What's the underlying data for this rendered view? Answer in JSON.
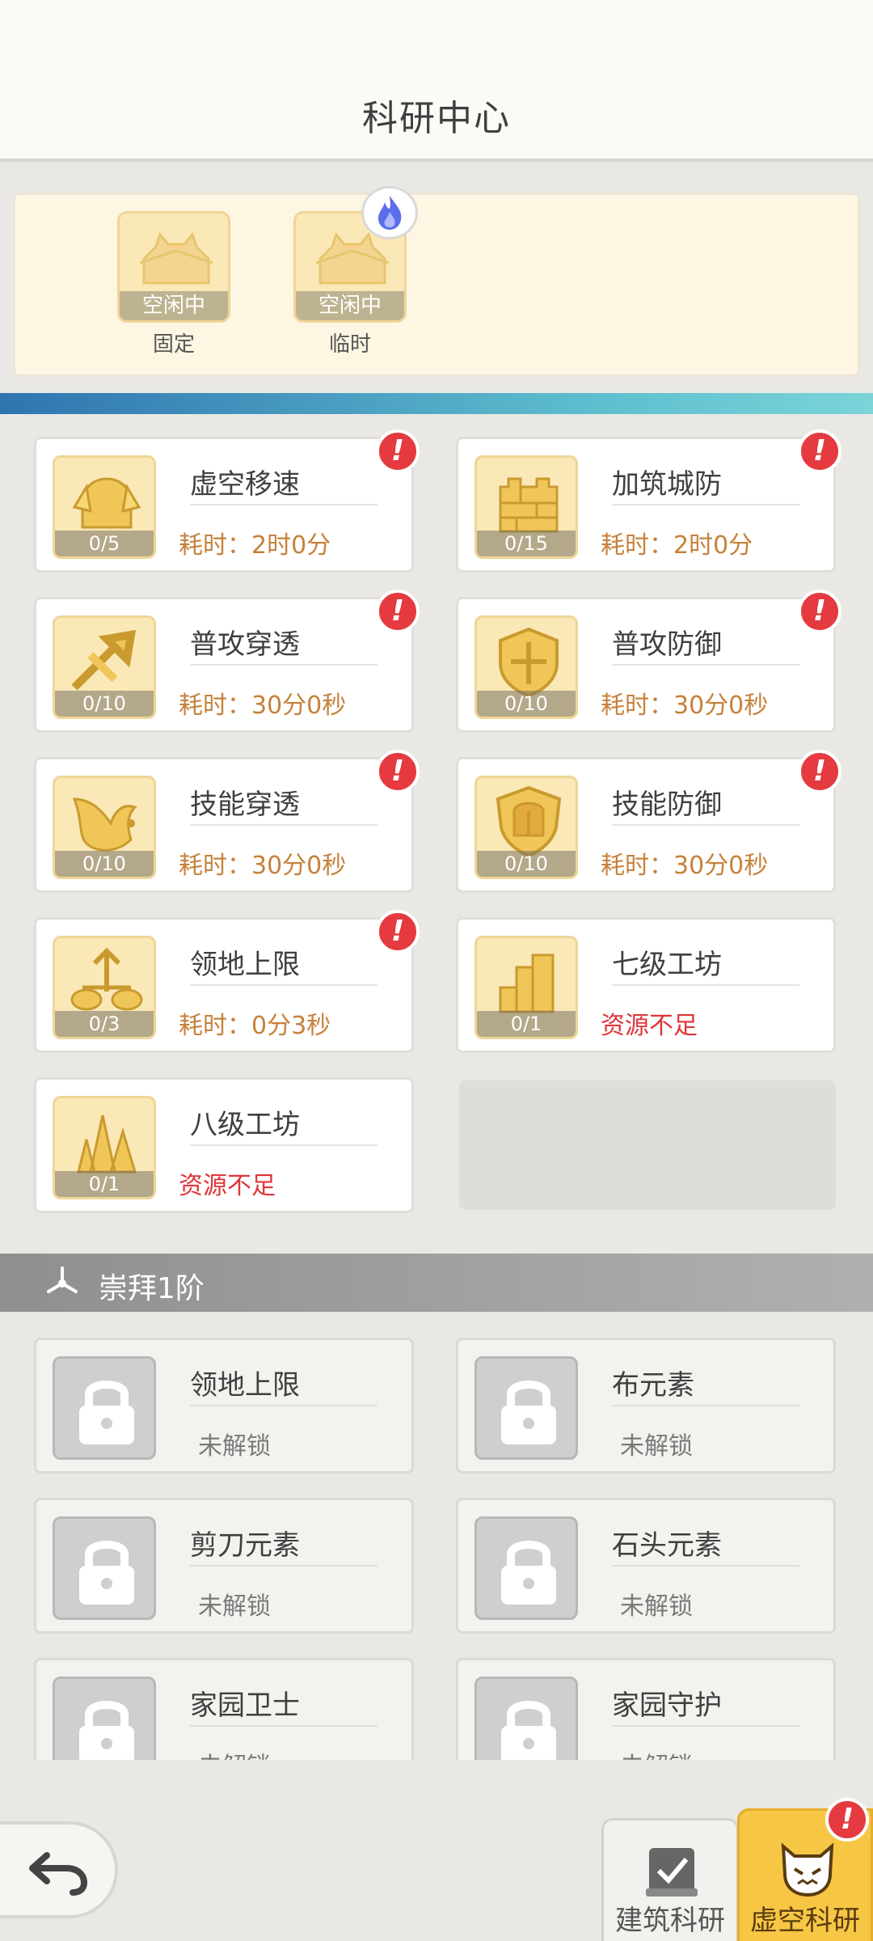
{
  "header": {
    "title": "科研中心"
  },
  "slots": [
    {
      "status": "空闲中",
      "caption": "固定"
    },
    {
      "status": "空闲中",
      "caption": "临时"
    }
  ],
  "tier_active": {
    "clipped_label": "崇拜1阶"
  },
  "research_items": [
    {
      "name": "虚空移速",
      "progress": "0/5",
      "sub": "耗时：2时0分",
      "alert": true
    },
    {
      "name": "加筑城防",
      "progress": "0/15",
      "sub": "耗时：2时0分",
      "alert": true
    },
    {
      "name": "普攻穿透",
      "progress": "0/10",
      "sub": "耗时：30分0秒",
      "alert": true
    },
    {
      "name": "普攻防御",
      "progress": "0/10",
      "sub": "耗时：30分0秒",
      "alert": true
    },
    {
      "name": "技能穿透",
      "progress": "0/10",
      "sub": "耗时：30分0秒",
      "alert": true
    },
    {
      "name": "技能防御",
      "progress": "0/10",
      "sub": "耗时：30分0秒",
      "alert": true
    },
    {
      "name": "领地上限",
      "progress": "0/3",
      "sub": "耗时：0分3秒",
      "alert": true
    },
    {
      "name": "七级工坊",
      "progress": "0/1",
      "sub": "资源不足",
      "alert": false
    },
    {
      "name": "八级工坊",
      "progress": "0/1",
      "sub": "资源不足",
      "alert": false
    }
  ],
  "tier_locked": {
    "label": "崇拜1阶"
  },
  "locked_items": [
    {
      "name": "领地上限",
      "sub": "未解锁"
    },
    {
      "name": "布元素",
      "sub": "未解锁"
    },
    {
      "name": "剪刀元素",
      "sub": "未解锁"
    },
    {
      "name": "石头元素",
      "sub": "未解锁"
    },
    {
      "name": "家园卫士",
      "sub": "未解锁"
    },
    {
      "name": "家园守护",
      "sub": "未解锁"
    }
  ],
  "alert_mark": "!",
  "bottom_tabs": [
    {
      "label": "建筑科研",
      "active": false
    },
    {
      "label": "虚空科研",
      "active": true
    }
  ],
  "colors": {
    "accent": "#f7c644",
    "alert": "#e53a3f",
    "time_text": "#c7813a",
    "insufficient_text": "#e0353b"
  }
}
